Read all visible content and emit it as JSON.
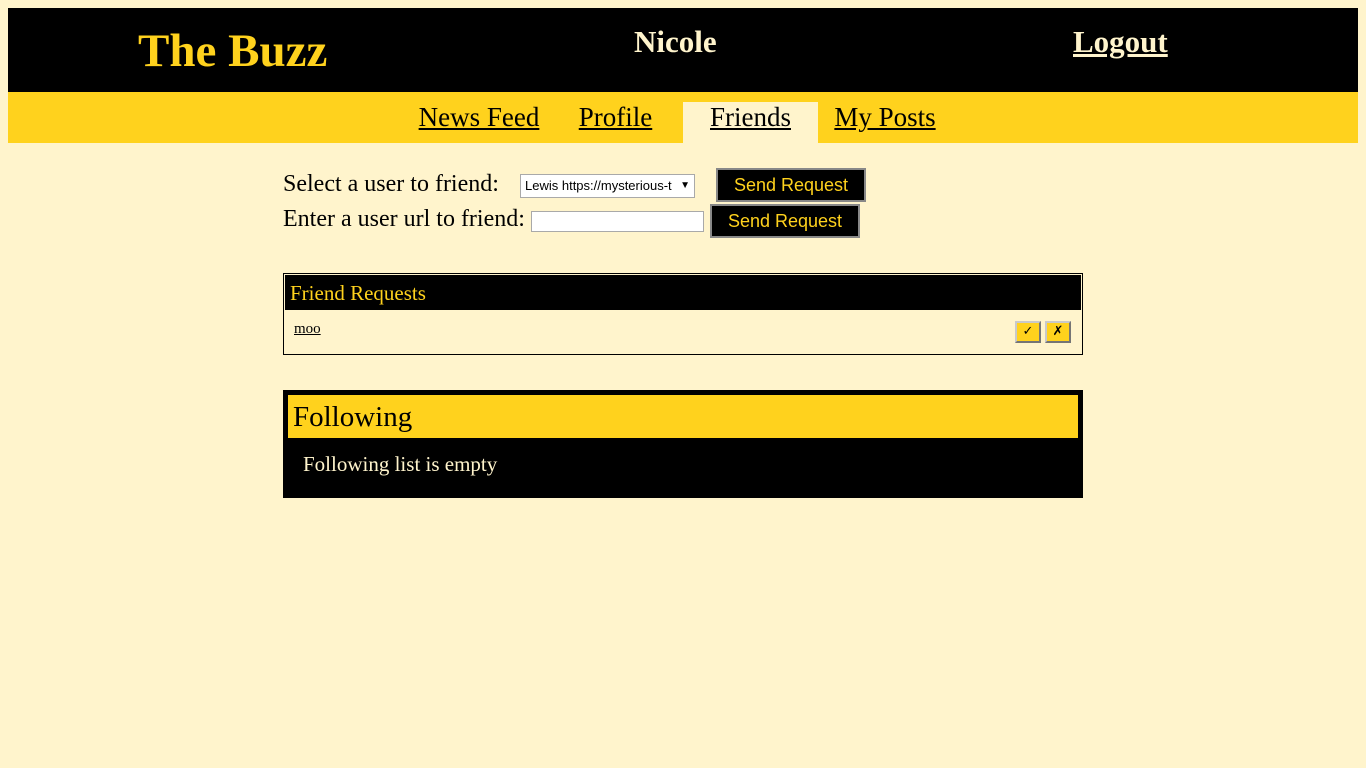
{
  "header": {
    "brand": "The Buzz",
    "username": "Nicole",
    "logout_label": "Logout"
  },
  "nav": {
    "tabs": [
      {
        "label": "News Feed",
        "active": false
      },
      {
        "label": "Profile",
        "active": false
      },
      {
        "label": "Friends",
        "active": true
      },
      {
        "label": "My Posts",
        "active": false
      }
    ]
  },
  "friend_form": {
    "select_label": "Select a user to friend:",
    "select_value": "Lewis https://mysterious-t",
    "url_label": "Enter a user url to friend:",
    "url_value": "",
    "send_label": "Send Request"
  },
  "friend_requests": {
    "title": "Friend Requests",
    "items": [
      {
        "user": "moo",
        "accept_icon": "✓",
        "reject_icon": "✗"
      }
    ]
  },
  "following": {
    "title": "Following",
    "empty_text": "Following list is empty"
  },
  "colors": {
    "background": "#fff4cc",
    "accent": "#ffd21d",
    "dark": "#000000"
  }
}
